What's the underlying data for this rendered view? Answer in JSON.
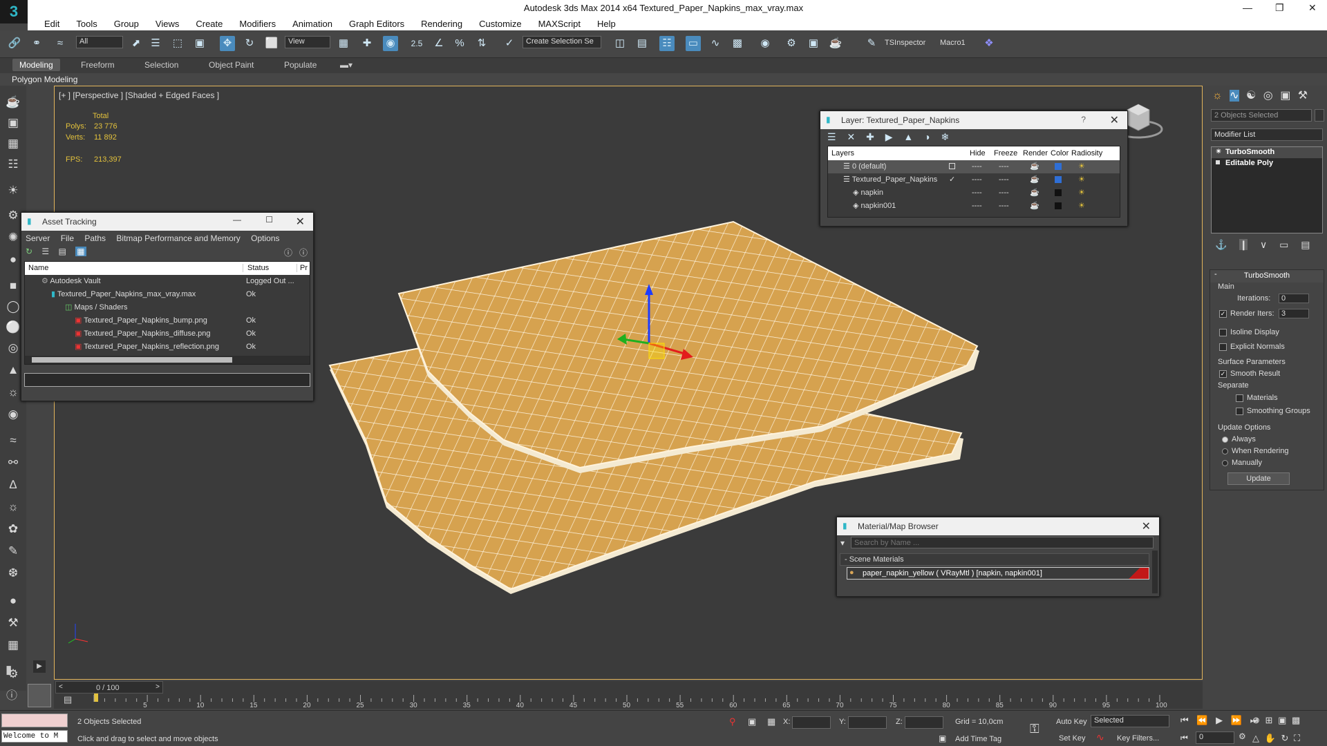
{
  "titlebar": {
    "title": "Autodesk 3ds Max  2014 x64     Textured_Paper_Napkins_max_vray.max",
    "logo": "3"
  },
  "menu": [
    "Edit",
    "Tools",
    "Group",
    "Views",
    "Create",
    "Modifiers",
    "Animation",
    "Graph Editors",
    "Rendering",
    "Customize",
    "MAXScript",
    "Help"
  ],
  "toolbar": {
    "selection_filter": "All",
    "ref_coord": "View",
    "named_selection": "Create Selection Se",
    "snap_label": "2.5",
    "angle_label": "%",
    "ts_inspector": "TSInspector",
    "macro": "Macro1"
  },
  "ribbon": {
    "tabs": [
      "Modeling",
      "Freeform",
      "Selection",
      "Object Paint",
      "Populate"
    ],
    "sub": "Polygon Modeling"
  },
  "viewport": {
    "label": "[+ ] [Perspective ] [Shaded + Edged Faces ]",
    "stats": {
      "total": "Total",
      "polys_label": "Polys:",
      "polys": "23 776",
      "verts_label": "Verts:",
      "verts": "11 892",
      "fps_label": "FPS:",
      "fps": "213,397"
    }
  },
  "asset_tracking": {
    "title": "Asset Tracking",
    "menu": [
      "Server",
      "File",
      "Paths",
      "Bitmap Performance and Memory",
      "Options"
    ],
    "columns": [
      "Name",
      "Status",
      "Pr"
    ],
    "rows": [
      {
        "name": "Autodesk Vault",
        "status": "Logged Out ..."
      },
      {
        "name": "Textured_Paper_Napkins_max_vray.max",
        "status": "Ok"
      },
      {
        "name": "Maps / Shaders",
        "status": ""
      },
      {
        "name": "Textured_Paper_Napkins_bump.png",
        "status": "Ok"
      },
      {
        "name": "Textured_Paper_Napkins_diffuse.png",
        "status": "Ok"
      },
      {
        "name": "Textured_Paper_Napkins_reflection.png",
        "status": "Ok"
      }
    ]
  },
  "layers": {
    "title": "Layer: Textured_Paper_Napkins",
    "help": "?",
    "columns": [
      "Layers",
      "Hide",
      "Freeze",
      "Render",
      "Color",
      "Radiosity"
    ],
    "rows": [
      {
        "name": "0 (default)",
        "color": "#2f6fd6"
      },
      {
        "name": "Textured_Paper_Napkins",
        "color": "#2f6fd6"
      },
      {
        "name": "napkin",
        "color": "#111111"
      },
      {
        "name": "napkin001",
        "color": "#111111"
      }
    ]
  },
  "material_browser": {
    "title": "Material/Map Browser",
    "search_placeholder": "Search by Name ...",
    "section": "- Scene Materials",
    "material": "paper_napkin_yellow  ( VRayMtl )  [napkin, napkin001]"
  },
  "command_panel": {
    "selected": "2 Objects Selected",
    "modifier_list": "Modifier List",
    "stack": [
      "TurboSmooth",
      "Editable Poly"
    ],
    "rollout": "TurboSmooth",
    "main": "Main",
    "iterations_label": "Iterations:",
    "iterations": "0",
    "render_iters_label": "Render Iters:",
    "render_iters": "3",
    "isoline": "Isoline Display",
    "explicit_normals": "Explicit Normals",
    "surface_params": "Surface Parameters",
    "smooth_result": "Smooth Result",
    "separate": "Separate",
    "materials": "Materials",
    "smoothing_groups": "Smoothing Groups",
    "update_options": "Update Options",
    "always": "Always",
    "when_rendering": "When Rendering",
    "manually": "Manually",
    "update_btn": "Update"
  },
  "timeline": {
    "frame": "0 / 100",
    "ticks": [
      "5",
      "10",
      "15",
      "20",
      "25",
      "30",
      "35",
      "40",
      "45",
      "50",
      "55",
      "60",
      "65",
      "70",
      "75",
      "80",
      "85",
      "90",
      "95",
      "100"
    ]
  },
  "status": {
    "welcome": "Welcome to M",
    "selected": "2 Objects Selected",
    "prompt": "Click and drag to select and move objects",
    "x_label": "X:",
    "y_label": "Y:",
    "z_label": "Z:",
    "grid": "Grid = 10,0cm",
    "add_time_tag": "Add Time Tag",
    "auto_key": "Auto Key",
    "set_key": "Set Key",
    "key_mode": "Selected",
    "key_filters": "Key Filters...",
    "frame_field": "0"
  },
  "colors": {
    "accent": "#4a8bbd",
    "viewport_border": "#e3b55c",
    "napkin": "#d9a657",
    "stat_text": "#e3c23c"
  }
}
